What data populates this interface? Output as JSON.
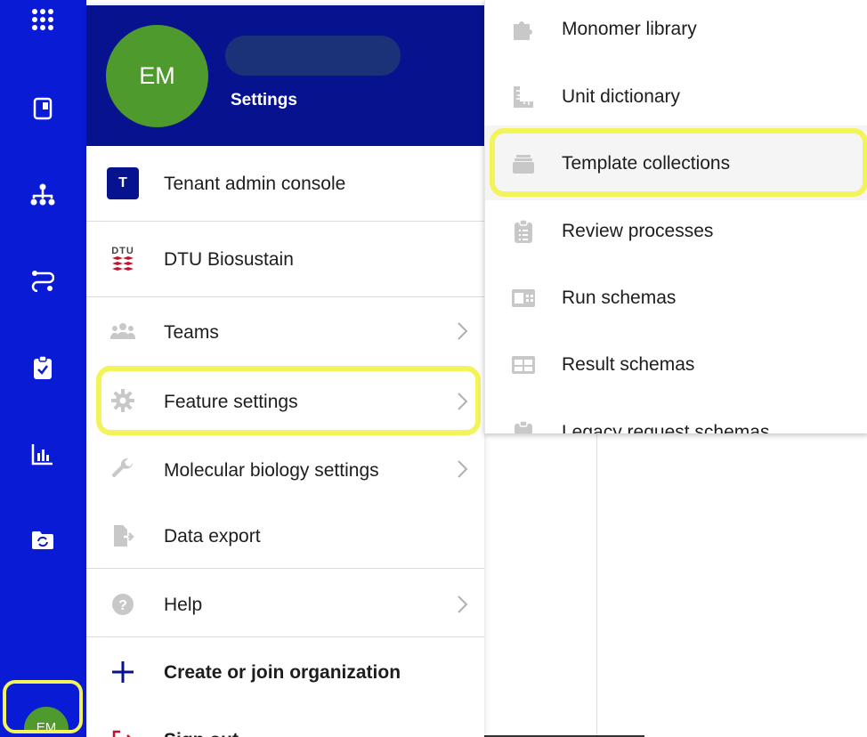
{
  "user": {
    "initials": "EM",
    "header_subtitle": "Settings"
  },
  "rail": {
    "icons": [
      "apps-grid-icon",
      "notebook-icon",
      "hierarchy-icon",
      "workflow-icon",
      "clipboard-check-icon",
      "bar-chart-icon",
      "folder-sync-icon"
    ],
    "avatar_initials": "EM"
  },
  "menu": {
    "tenant_admin": {
      "icon_letter": "T",
      "label": "Tenant admin console"
    },
    "organization": {
      "logo_text": "DTU",
      "label": "DTU Biosustain"
    },
    "teams": "Teams",
    "feature_settings": "Feature settings",
    "molecular_biology_settings": "Molecular biology settings",
    "data_export": "Data export",
    "help": "Help",
    "create_org": "Create or join organization",
    "partial_item": "Sign out"
  },
  "submenu": {
    "items": [
      "Monomer library",
      "Unit dictionary",
      "Template collections",
      "Review processes",
      "Run schemas",
      "Result schemas",
      "Legacy request schemas"
    ]
  },
  "colors": {
    "rail": "#0a1bd6",
    "header": "#06128e",
    "avatar": "#4f9a2d",
    "highlight": "#f3f35a"
  }
}
